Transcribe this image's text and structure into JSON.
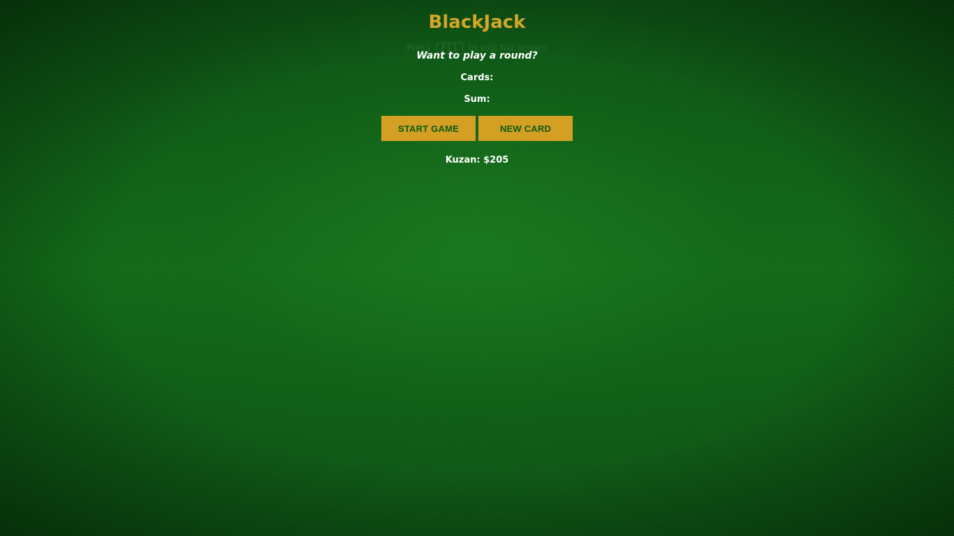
{
  "overlay_hint": {
    "prefix": "Press",
    "key": "F11",
    "suffix": "to exit full screen"
  },
  "game": {
    "title": "BlackJack",
    "message": "Want to play a round?",
    "cards_label": "Cards:",
    "sum_label": "Sum:",
    "player_label": "Kuzan: $205"
  },
  "controls": {
    "start_label": "START GAME",
    "new_card_label": "NEW CARD"
  },
  "colors": {
    "felt": "#0b5a12",
    "accent_gold": "#d4a024",
    "button_text": "#0b5a12",
    "text": "#ffffff"
  }
}
